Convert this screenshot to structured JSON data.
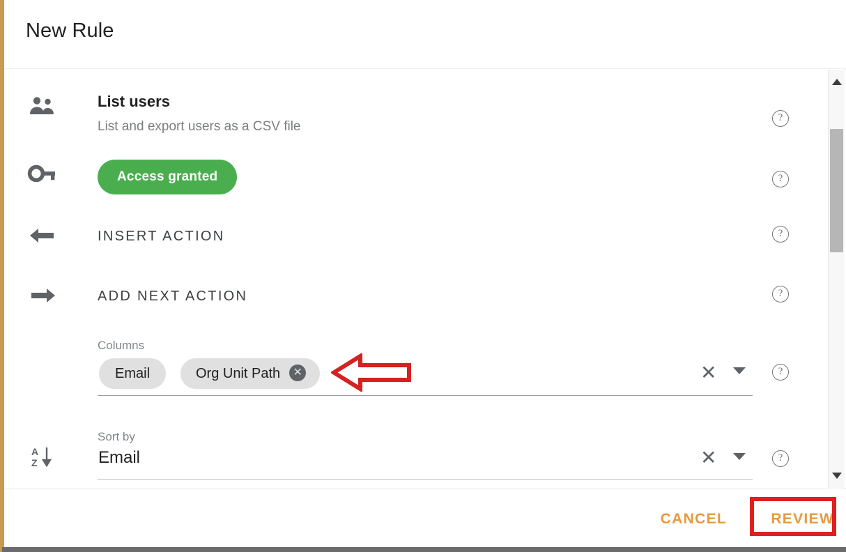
{
  "dialog": {
    "title": "New Rule"
  },
  "rows": {
    "list_users": {
      "icon": "people-icon",
      "title": "List users",
      "subtitle": "List and export users as a CSV file",
      "help": "?"
    },
    "access": {
      "icon": "key-icon",
      "chip_label": "Access granted",
      "chip_color": "#4aae4f",
      "help": "?"
    },
    "insert_action": {
      "icon": "arrow-left-icon",
      "label": "INSERT ACTION",
      "help": "?"
    },
    "add_next_action": {
      "icon": "arrow-right-icon",
      "label": "ADD NEXT ACTION",
      "help": "?"
    },
    "columns": {
      "label": "Columns",
      "chips": [
        {
          "label": "Email",
          "removable": false
        },
        {
          "label": "Org Unit Path",
          "removable": true,
          "remove_glyph": "✕"
        }
      ],
      "clear_glyph": "✕",
      "dropdown_icon": "chevron-down-icon",
      "help": "?"
    },
    "sort_by": {
      "icon": "sort-az-descending-icon",
      "icon_letters": "A\nZ",
      "label": "Sort by",
      "value": "Email",
      "clear_glyph": "✕",
      "dropdown_icon": "chevron-down-icon",
      "help": "?"
    }
  },
  "scrollbar": {
    "up_arrow": "scroll-up-arrow",
    "down_arrow": "scroll-down-arrow",
    "thumb": "scroll-thumb"
  },
  "footer": {
    "cancel_label": "CANCEL",
    "review_label": "REVIEW",
    "button_color": "#e8993b"
  },
  "annotations": {
    "highlight_color": "#e02020",
    "highlight_target": "REVIEW",
    "arrow_direction": "left",
    "arrow_target": "columns-field"
  }
}
